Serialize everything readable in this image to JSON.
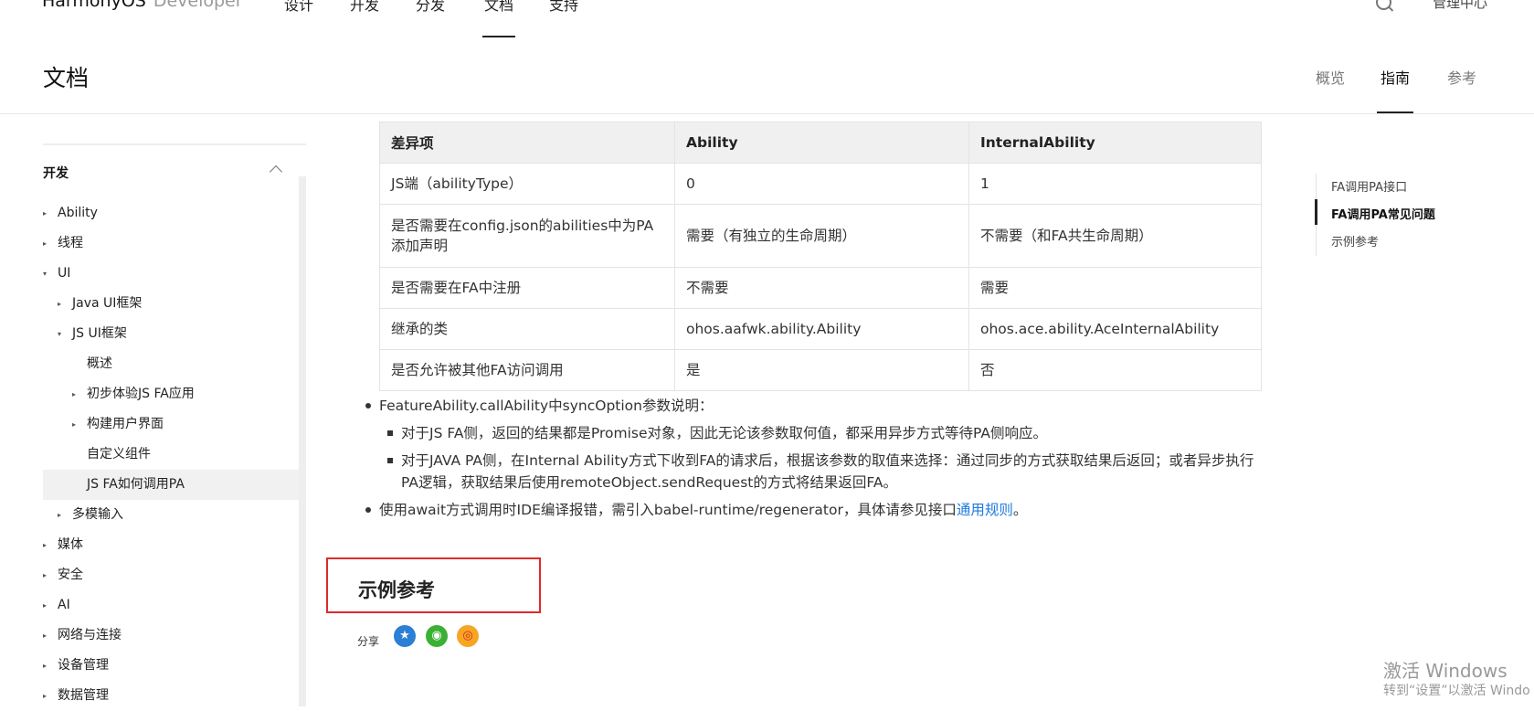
{
  "topnav": {
    "brand": "HarmonyOS",
    "brand_sub": "Developer",
    "items": [
      "设计",
      "开发",
      "分发",
      "文档",
      "支持"
    ],
    "manage_center": "管理中心"
  },
  "doc_header": {
    "title": "文档",
    "tabs": [
      "概览",
      "指南",
      "参考"
    ]
  },
  "sidebar": {
    "section_title": "开发",
    "items": [
      {
        "label": "Ability",
        "arrow": "▸"
      },
      {
        "label": "线程",
        "arrow": "▸"
      },
      {
        "label": "UI",
        "arrow": "▾"
      },
      {
        "label": "Java UI框架",
        "arrow": "▸"
      },
      {
        "label": "JS UI框架",
        "arrow": "▾"
      },
      {
        "label": "概述",
        "arrow": ""
      },
      {
        "label": "初步体验JS FA应用",
        "arrow": "▸"
      },
      {
        "label": "构建用户界面",
        "arrow": "▸"
      },
      {
        "label": "自定义组件",
        "arrow": ""
      },
      {
        "label": "JS FA如何调用PA",
        "arrow": ""
      },
      {
        "label": "多模输入",
        "arrow": "▸"
      },
      {
        "label": "媒体",
        "arrow": "▸"
      },
      {
        "label": "安全",
        "arrow": "▸"
      },
      {
        "label": "AI",
        "arrow": "▸"
      },
      {
        "label": "网络与连接",
        "arrow": "▸"
      },
      {
        "label": "设备管理",
        "arrow": "▸"
      },
      {
        "label": "数据管理",
        "arrow": "▸"
      }
    ]
  },
  "table": {
    "headers": [
      "差异项",
      "Ability",
      "InternalAbility"
    ],
    "rows": [
      [
        "JS端（abilityType）",
        "0",
        "1"
      ],
      [
        "是否需要在config.json的abilities中为PA添加声明",
        "需要（有独立的生命周期）",
        "不需要（和FA共生命周期）"
      ],
      [
        "是否需要在FA中注册",
        "不需要",
        "需要"
      ],
      [
        "继承的类",
        "ohos.aafwk.ability.Ability",
        "ohos.ace.ability.AceInternalAbility"
      ],
      [
        "是否允许被其他FA访问调用",
        "是",
        "否"
      ]
    ]
  },
  "notes": {
    "item1": "FeatureAbility.callAbility中syncOption参数说明：",
    "sub1": "对于JS FA侧，返回的结果都是Promise对象，因此无论该参数取何值，都采用异步方式等待PA侧响应。",
    "sub2": "对于JAVA PA侧，在Internal Ability方式下收到FA的请求后，根据该参数的取值来选择：通过同步的方式获取结果后返回；或者异步执行PA逻辑，获取结果后使用remoteObject.sendRequest的方式将结果返回FA。",
    "item2_pre": "使用await方式调用时IDE编译报错，需引入babel-runtime/regenerator，具体请参见接口",
    "item2_link": "通用规则",
    "item2_post": "。"
  },
  "example": {
    "title": "示例参考",
    "share_label": "分享"
  },
  "toc": {
    "items": [
      "FA调用PA接口",
      "FA调用PA常见问题",
      "示例参考"
    ]
  },
  "watermark": {
    "line1": "激活 Windows",
    "line2": "转到“设置”以激活 Windo"
  },
  "colors": {
    "link": "#1f7ae0",
    "highlight_border": "#e02a2a"
  }
}
